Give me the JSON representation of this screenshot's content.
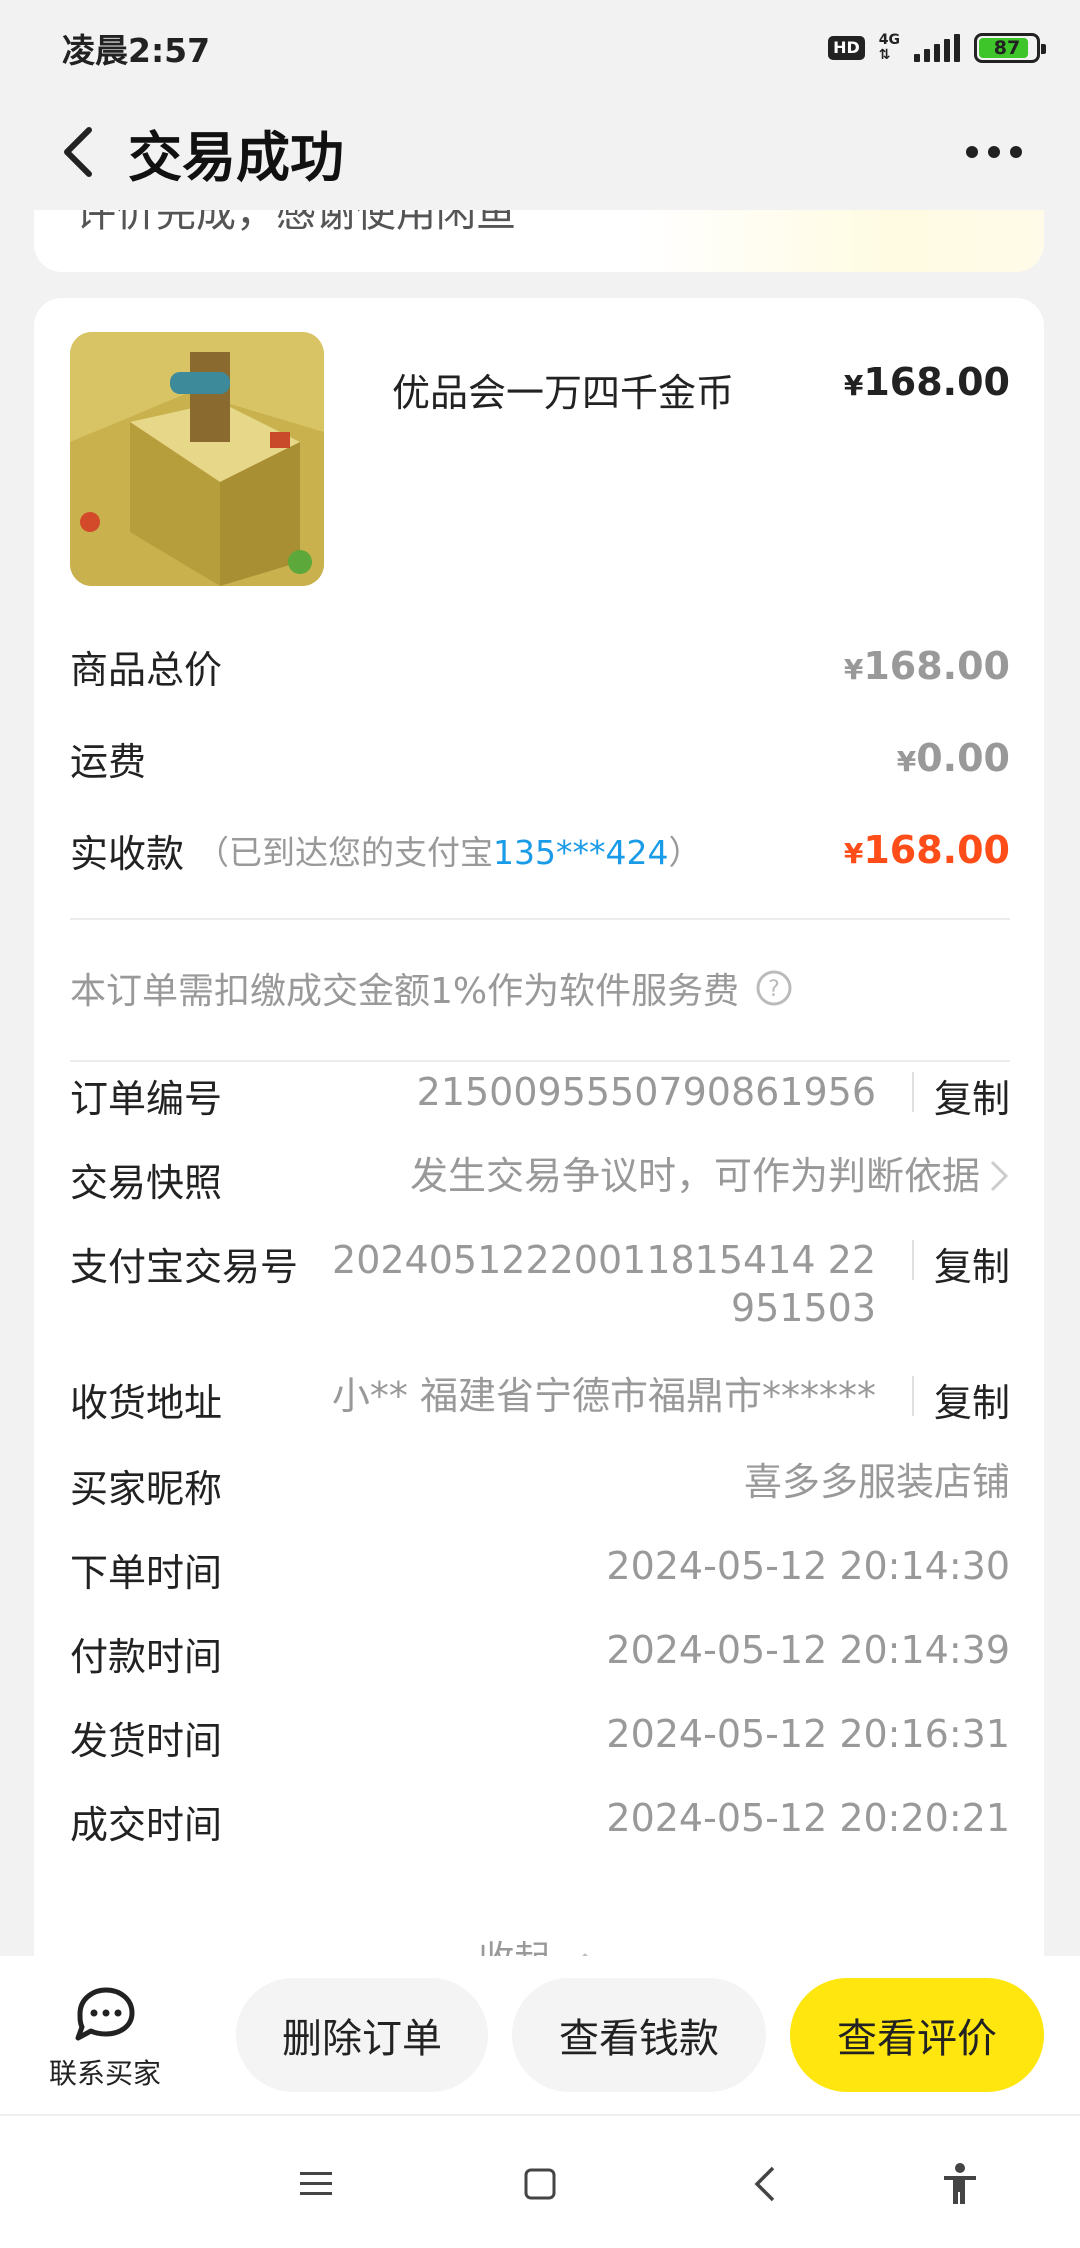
{
  "status_bar": {
    "time": "凌晨2:57",
    "hd": "HD",
    "network": "4G",
    "battery": "87",
    "battery_level": 0.87
  },
  "header": {
    "title": "交易成功",
    "back_icon": "chevron-left-icon",
    "more_icon": "more-dots-icon"
  },
  "notice": {
    "text": "评价完成，感谢使用闲鱼"
  },
  "product": {
    "name": "优品会一万四千金币",
    "price": "168.00",
    "currency": "¥"
  },
  "prices": {
    "total_label": "商品总价",
    "total_value": "168.00",
    "shipping_label": "运费",
    "shipping_value": "0.00",
    "received_label": "实收款",
    "received_note_prefix": "（已到达您的支付宝",
    "received_account": "135***424",
    "received_note_suffix": "）",
    "received_value": "168.00",
    "currency": "¥"
  },
  "fee_notice": "本订单需扣缴成交金额1%作为软件服务费",
  "details": {
    "order_no_label": "订单编号",
    "order_no": "2150095550790861956",
    "snapshot_label": "交易快照",
    "snapshot_value": "发生交易争议时，可作为判断依据",
    "alipay_label": "支付宝交易号",
    "alipay_line1": "20240512220011815414 22",
    "alipay_line2": "951503",
    "address_label": "收货地址",
    "address_value": "小** 福建省宁德市福鼎市******",
    "buyer_label": "买家昵称",
    "buyer_value": "喜多多服装店铺",
    "order_time_label": "下单时间",
    "order_time": "2024-05-12 20:14:30",
    "pay_time_label": "付款时间",
    "pay_time": "2024-05-12 20:14:39",
    "ship_time_label": "发货时间",
    "ship_time": "2024-05-12 20:16:31",
    "deal_time_label": "成交时间",
    "deal_time": "2024-05-12 20:20:21",
    "copy_label": "复制"
  },
  "collapse_label": "收起",
  "actions": {
    "contact_label": "联系买家",
    "delete_label": "删除订单",
    "view_money_label": "查看钱款",
    "view_review_label": "查看评价"
  },
  "colors": {
    "accent_yellow": "#ffe60f",
    "price_red": "#ff4d19",
    "link_blue": "#1a9be8",
    "background": "#f2f2f2"
  }
}
